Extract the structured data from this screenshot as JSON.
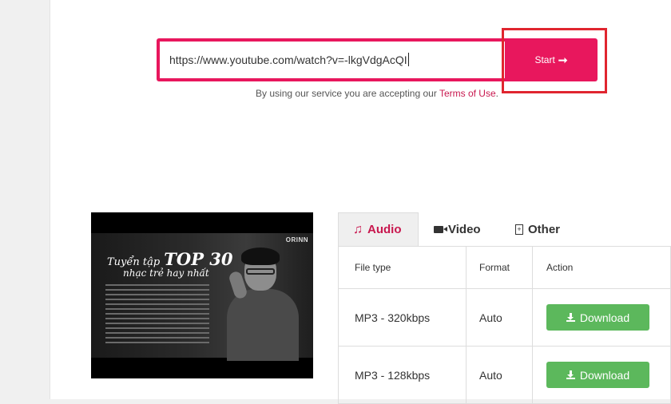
{
  "search": {
    "url_value": "https://www.youtube.com/watch?v=-lkgVdgAcQI",
    "start_label": "Start",
    "start_arrow": "➞"
  },
  "terms": {
    "prefix": "By using our service you are accepting our ",
    "link": "Terms of Use",
    "suffix": "."
  },
  "thumbnail": {
    "brand": "ORINN",
    "title_prefix": "Tuyển tập",
    "title_main": "TOP 30",
    "subtitle": "nhạc trẻ hay nhất"
  },
  "tabs": [
    {
      "label": "Audio",
      "icon": "music-icon",
      "active": true
    },
    {
      "label": "Video",
      "icon": "video-camera-icon",
      "active": false
    },
    {
      "label": "Other",
      "icon": "file-icon",
      "active": false
    }
  ],
  "table": {
    "headers": [
      "File type",
      "Format",
      "Action"
    ],
    "rows": [
      {
        "file_type": "MP3 - 320kbps",
        "format": "Auto",
        "action": "Download"
      },
      {
        "file_type": "MP3 - 128kbps",
        "format": "Auto",
        "action": "Download"
      }
    ]
  },
  "colors": {
    "accent": "#e8175d",
    "highlight": "#e0252f",
    "download": "#5cb85c",
    "link": "#c8174e"
  }
}
